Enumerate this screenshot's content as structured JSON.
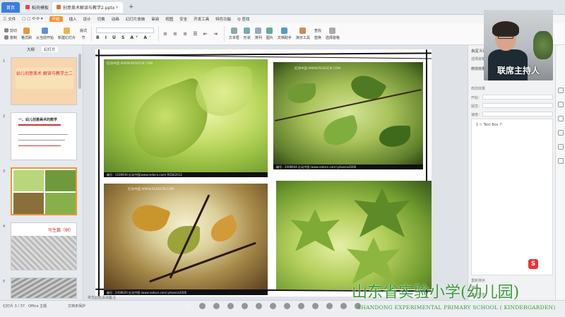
{
  "tabs": [
    {
      "label": "首页",
      "kind": "home"
    },
    {
      "label": "稻壳模板"
    },
    {
      "label": "创意美术解读与教学2.pptx"
    }
  ],
  "menu": {
    "file": "三 文件",
    "items": [
      "开始",
      "插入",
      "设计",
      "切换",
      "动画",
      "幻灯片放映",
      "审阅",
      "视图",
      "安全",
      "开发工具",
      "特色功能",
      "Q 查找"
    ],
    "active": "开始"
  },
  "ribbon": {
    "cut": "剪切",
    "copy": "复制",
    "format_painter": "格式刷",
    "paste": "粘贴",
    "from_start": "从当前开始",
    "new_slide": "新建幻灯片",
    "layout": "版式",
    "section": "节",
    "reset": "重置",
    "font": "",
    "textbox": "文本框",
    "shape": "形状",
    "arrange": "排列",
    "picture": "图片",
    "animation": "文档助手",
    "presentation": "演示工具",
    "find": "查找",
    "replace": "替换",
    "select": "选择窗格"
  },
  "left_panel": {
    "tab_outline": "大纲",
    "tab_slides": "幻灯片",
    "slides": [
      {
        "num": "1",
        "title": "幼儿创意美术 解读与教学之二"
      },
      {
        "num": "2",
        "title": "一、幼儿创意美术的教学"
      },
      {
        "num": "3",
        "title": ""
      },
      {
        "num": "4",
        "title": "写生篇（树）"
      },
      {
        "num": "5",
        "title": ""
      }
    ]
  },
  "slide_images": [
    {
      "watermark": "红动中国 WWW.REDOCN.COM",
      "caption": "编号：1169939  红动中国(www.redocn.com)  ROSE2012"
    },
    {
      "watermark": "红动中国 WWW.REDOCN.COM",
      "caption": "编号：2408944  红动中国 (www.redocn.com)  phoenix2006"
    },
    {
      "watermark": "红动中国 WWW.REDOCN.COM",
      "caption": "编号：2408020  红动中国 (www.redocn.com)  phoenix2006"
    },
    {
      "watermark": "",
      "caption": ""
    }
  ],
  "right_panel": {
    "title": "自定义动画",
    "select_label": "选择窗格",
    "effect_label": "修改效果",
    "start_label": "开始：",
    "prop_label": "属性：",
    "speed_label": "速度：",
    "list_item": "1  ✩  Text Box 7:",
    "reorder": "重新排序",
    "play": "播放",
    "slideshow": "幻灯片播放",
    "autopreview": "自动预览"
  },
  "video": {
    "name": "联席主持人"
  },
  "status": {
    "slide_info": "幻灯片 3 / 37",
    "theme": "Office 主题",
    "protect": "文档未保护",
    "notes": "单击此处添加备注"
  },
  "school": {
    "cn": "山东省实验小学(幼儿园)",
    "en": "SHANDONG EXPERIMENTAL PRIMARY SCHOOL ( KINDERGARDEN)"
  },
  "colors": {
    "accent": "#f2922f",
    "home_tab": "#3b7ddd",
    "school_green": "#3a9a3a"
  },
  "pager": {
    "dot_count": 13,
    "current_index": 0
  }
}
